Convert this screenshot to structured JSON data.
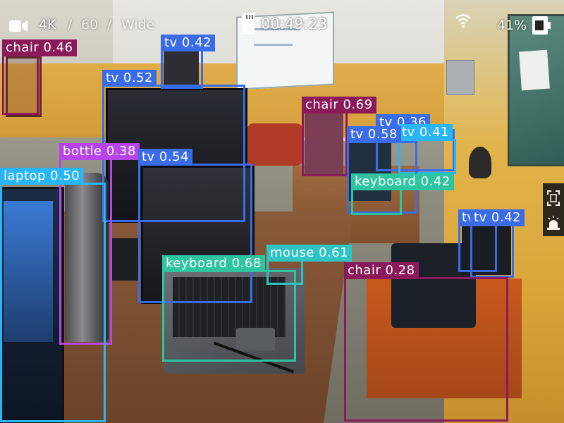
{
  "hud": {
    "camera_icon": "video-camera-icon",
    "resolution": "4K",
    "separator1": "/",
    "fps": "60",
    "separator2": "/",
    "lens": "Wide",
    "sd_icon": "sd-card-icon",
    "timer": "00:49:23",
    "wifi_icon": "wifi-icon",
    "battery_percent": "41%",
    "battery_icon": "battery-icon",
    "side_controls": [
      "frame-icon",
      "alarm-icon"
    ]
  },
  "detections": [
    {
      "label": "chair 0.46",
      "color": "#8B1A5A"
    },
    {
      "label": "tv 0.42",
      "color": "#3B6CE8"
    },
    {
      "label": "tv 0.52",
      "color": "#3B6CE8"
    },
    {
      "label": "chair 0.69",
      "color": "#8B1A5A"
    },
    {
      "label": "tv 0.36",
      "color": "#3B6CE8"
    },
    {
      "label": "tv 0.41",
      "color": "#29B6F6"
    },
    {
      "label": "tv 0.58",
      "color": "#3B6CE8"
    },
    {
      "label": "bottle 0.38",
      "color": "#B845E8"
    },
    {
      "label": "tv 0.54",
      "color": "#3B6CE8"
    },
    {
      "label": "laptop 0.50",
      "color": "#29B6F6"
    },
    {
      "label": "keyboard 0.42",
      "color": "#2EC4A0"
    },
    {
      "label": "tv",
      "color": "#3B6CE8"
    },
    {
      "label": "tv 0.42",
      "color": "#3B6CE8"
    },
    {
      "label": "mouse 0.61",
      "color": "#2EC4C4"
    },
    {
      "label": "keyboard 0.68",
      "color": "#2EC4A0"
    },
    {
      "label": "chair 0.28",
      "color": "#8B1A5A"
    }
  ]
}
